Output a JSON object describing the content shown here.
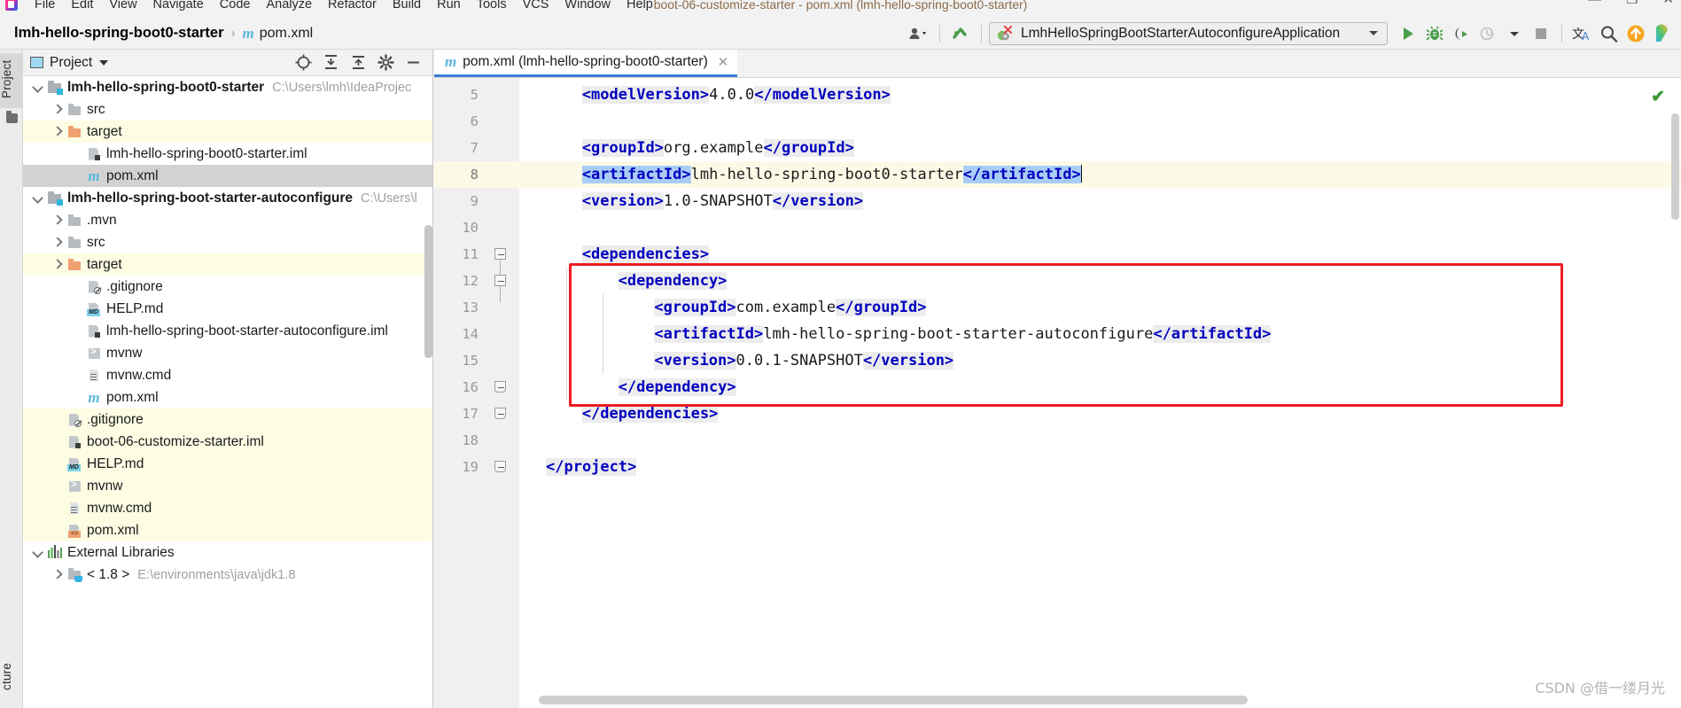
{
  "window": {
    "title": "boot-06-customize-starter - pom.xml (lmh-hello-spring-boot0-starter)",
    "minimize": "—",
    "maximize": "❐",
    "close": "✕"
  },
  "menubar": {
    "items": [
      "File",
      "Edit",
      "View",
      "Navigate",
      "Code",
      "Analyze",
      "Refactor",
      "Build",
      "Run",
      "Tools",
      "VCS",
      "Window",
      "Help"
    ]
  },
  "breadcrumb": {
    "root": "lmh-hello-spring-boot0-starter",
    "separator": "›",
    "file": "pom.xml",
    "file_icon": "maven-m-icon"
  },
  "toolbar": {
    "run_config": "LmhHelloSpringBootStarterAutoconfigureApplication",
    "icons": [
      "user-dropdown-icon",
      "update-project-icon",
      "run-icon",
      "debug-icon",
      "run-with-coverage-icon",
      "profile-icon",
      "stop-icon",
      "translate-icon",
      "search-everywhere-icon",
      "upload-icon",
      "plugin-icon"
    ]
  },
  "left_strip": {
    "project_tab": "Project",
    "structure_tab": "cture"
  },
  "project_panel": {
    "title": "Project",
    "tree": [
      {
        "indent": 0,
        "arrow": "down",
        "icon": "module-icon",
        "label": "lmh-hello-spring-boot0-starter",
        "bold": true,
        "path": "C:\\Users\\lmh\\IdeaProjec",
        "bg": "none"
      },
      {
        "indent": 1,
        "arrow": "right",
        "icon": "folder-icon",
        "label": "src",
        "bold": false,
        "path": "",
        "bg": "none"
      },
      {
        "indent": 1,
        "arrow": "right",
        "icon": "target-folder-icon",
        "label": "target",
        "bold": false,
        "path": "",
        "bg": "yellow"
      },
      {
        "indent": 2,
        "arrow": "none",
        "icon": "iml-file-icon",
        "label": "lmh-hello-spring-boot0-starter.iml",
        "bold": false,
        "path": "",
        "bg": "none"
      },
      {
        "indent": 2,
        "arrow": "none",
        "icon": "maven-m-icon",
        "label": "pom.xml",
        "bold": false,
        "path": "",
        "bg": "selected"
      },
      {
        "indent": 0,
        "arrow": "down",
        "icon": "module-icon",
        "label": "lmh-hello-spring-boot-starter-autoconfigure",
        "bold": true,
        "path": "C:\\Users\\l",
        "bg": "none"
      },
      {
        "indent": 1,
        "arrow": "right",
        "icon": "folder-icon",
        "label": ".mvn",
        "bold": false,
        "path": "",
        "bg": "none"
      },
      {
        "indent": 1,
        "arrow": "right",
        "icon": "folder-icon",
        "label": "src",
        "bold": false,
        "path": "",
        "bg": "none"
      },
      {
        "indent": 1,
        "arrow": "right",
        "icon": "target-folder-icon",
        "label": "target",
        "bold": false,
        "path": "",
        "bg": "yellow"
      },
      {
        "indent": 2,
        "arrow": "none",
        "icon": "gitignore-icon",
        "label": ".gitignore",
        "bold": false,
        "path": "",
        "bg": "none"
      },
      {
        "indent": 2,
        "arrow": "none",
        "icon": "markdown-icon",
        "label": "HELP.md",
        "bold": false,
        "path": "",
        "bg": "none"
      },
      {
        "indent": 2,
        "arrow": "none",
        "icon": "iml-file-icon",
        "label": "lmh-hello-spring-boot-starter-autoconfigure.iml",
        "bold": false,
        "path": "",
        "bg": "none"
      },
      {
        "indent": 2,
        "arrow": "none",
        "icon": "shell-script-icon",
        "label": "mvnw",
        "bold": false,
        "path": "",
        "bg": "none"
      },
      {
        "indent": 2,
        "arrow": "none",
        "icon": "cmd-script-icon",
        "label": "mvnw.cmd",
        "bold": false,
        "path": "",
        "bg": "none"
      },
      {
        "indent": 2,
        "arrow": "none",
        "icon": "maven-m-icon",
        "label": "pom.xml",
        "bold": false,
        "path": "",
        "bg": "none"
      },
      {
        "indent": 1,
        "arrow": "none",
        "icon": "gitignore-icon",
        "label": ".gitignore",
        "bold": false,
        "path": "",
        "bg": "yellow"
      },
      {
        "indent": 1,
        "arrow": "none",
        "icon": "iml-file-icon",
        "label": "boot-06-customize-starter.iml",
        "bold": false,
        "path": "",
        "bg": "yellow"
      },
      {
        "indent": 1,
        "arrow": "none",
        "icon": "markdown-icon",
        "label": "HELP.md",
        "bold": false,
        "path": "",
        "bg": "yellow"
      },
      {
        "indent": 1,
        "arrow": "none",
        "icon": "shell-script-icon",
        "label": "mvnw",
        "bold": false,
        "path": "",
        "bg": "yellow"
      },
      {
        "indent": 1,
        "arrow": "none",
        "icon": "cmd-script-icon",
        "label": "mvnw.cmd",
        "bold": false,
        "path": "",
        "bg": "yellow"
      },
      {
        "indent": 1,
        "arrow": "none",
        "icon": "xml-file-icon",
        "label": "pom.xml",
        "bold": false,
        "path": "",
        "bg": "yellow"
      },
      {
        "indent": 0,
        "arrow": "down",
        "icon": "external-libraries-icon",
        "label": "External Libraries",
        "bold": false,
        "path": "",
        "bg": "none"
      },
      {
        "indent": 1,
        "arrow": "right",
        "icon": "jdk-icon",
        "label": "< 1.8 >",
        "bold": false,
        "path": "E:\\environments\\java\\jdk1.8",
        "bg": "none"
      }
    ]
  },
  "editor": {
    "tab": {
      "icon": "maven-m-icon",
      "label": "pom.xml (lmh-hello-spring-boot0-starter)",
      "close": "✕"
    },
    "inspection_status": "✔",
    "lines": [
      {
        "no": 5,
        "indent": 2,
        "fold": "none",
        "bulb": false,
        "cur": false,
        "parts": [
          {
            "t": "tag",
            "v": "<modelVersion>"
          },
          {
            "t": "txt",
            "v": "4.0.0"
          },
          {
            "t": "tag",
            "v": "</modelVersion>"
          }
        ]
      },
      {
        "no": 6,
        "indent": 2,
        "fold": "none",
        "bulb": false,
        "cur": false,
        "parts": []
      },
      {
        "no": 7,
        "indent": 2,
        "fold": "none",
        "bulb": false,
        "cur": false,
        "parts": [
          {
            "t": "tag",
            "v": "<groupId>"
          },
          {
            "t": "txt",
            "v": "org.example"
          },
          {
            "t": "tag",
            "v": "</groupId>"
          }
        ]
      },
      {
        "no": 8,
        "indent": 2,
        "fold": "none",
        "bulb": true,
        "cur": true,
        "parts": [
          {
            "t": "sel",
            "v": "<artifactId>"
          },
          {
            "t": "txt",
            "v": "lmh-hello-spring-boot0-starter"
          },
          {
            "t": "sel",
            "v": "</artifactId>"
          },
          {
            "t": "caret",
            "v": ""
          }
        ]
      },
      {
        "no": 9,
        "indent": 2,
        "fold": "none",
        "bulb": false,
        "cur": false,
        "parts": [
          {
            "t": "tag",
            "v": "<version>"
          },
          {
            "t": "txt",
            "v": "1.0-SNAPSHOT"
          },
          {
            "t": "tag",
            "v": "</version>"
          }
        ]
      },
      {
        "no": 10,
        "indent": 2,
        "fold": "none",
        "bulb": false,
        "cur": false,
        "parts": []
      },
      {
        "no": 11,
        "indent": 2,
        "fold": "start",
        "bulb": false,
        "cur": false,
        "parts": [
          {
            "t": "tag",
            "v": "<dependencies>"
          }
        ]
      },
      {
        "no": 12,
        "indent": 4,
        "fold": "start",
        "bulb": false,
        "cur": false,
        "parts": [
          {
            "t": "tag",
            "v": "<dependency>"
          }
        ]
      },
      {
        "no": 13,
        "indent": 6,
        "fold": "none",
        "bulb": false,
        "cur": false,
        "parts": [
          {
            "t": "tag",
            "v": "<groupId>"
          },
          {
            "t": "txt",
            "v": "com.example"
          },
          {
            "t": "tag",
            "v": "</groupId>"
          }
        ]
      },
      {
        "no": 14,
        "indent": 6,
        "fold": "none",
        "bulb": false,
        "cur": false,
        "parts": [
          {
            "t": "tag",
            "v": "<artifactId>"
          },
          {
            "t": "txt",
            "v": "lmh-hello-spring-boot-starter-autoconfigure"
          },
          {
            "t": "tag",
            "v": "</artifactId>"
          }
        ]
      },
      {
        "no": 15,
        "indent": 6,
        "fold": "none",
        "bulb": false,
        "cur": false,
        "parts": [
          {
            "t": "tag",
            "v": "<version>"
          },
          {
            "t": "txt",
            "v": "0.0.1-SNAPSHOT"
          },
          {
            "t": "tag",
            "v": "</version>"
          }
        ]
      },
      {
        "no": 16,
        "indent": 4,
        "fold": "end",
        "bulb": false,
        "cur": false,
        "parts": [
          {
            "t": "tag",
            "v": "</dependency>"
          }
        ]
      },
      {
        "no": 17,
        "indent": 2,
        "fold": "end",
        "bulb": false,
        "cur": false,
        "parts": [
          {
            "t": "tag",
            "v": "</dependencies>"
          }
        ]
      },
      {
        "no": 18,
        "indent": 2,
        "fold": "none",
        "bulb": false,
        "cur": false,
        "parts": []
      },
      {
        "no": 19,
        "indent": 0,
        "fold": "end",
        "bulb": false,
        "cur": false,
        "parts": [
          {
            "t": "tag",
            "v": "</project>"
          }
        ]
      }
    ],
    "annotation": {
      "type": "red-rectangle",
      "covers_lines": "12-16"
    }
  },
  "watermark": "CSDN @借一缕月光",
  "colors": {
    "tag_blue": "#0000c0",
    "annotation_red": "#ee1c24",
    "tab_underline": "#3b80d8",
    "selection_blue": "#a8cdf5",
    "current_line": "#fcfae6",
    "target_folder": "#f0a070"
  }
}
